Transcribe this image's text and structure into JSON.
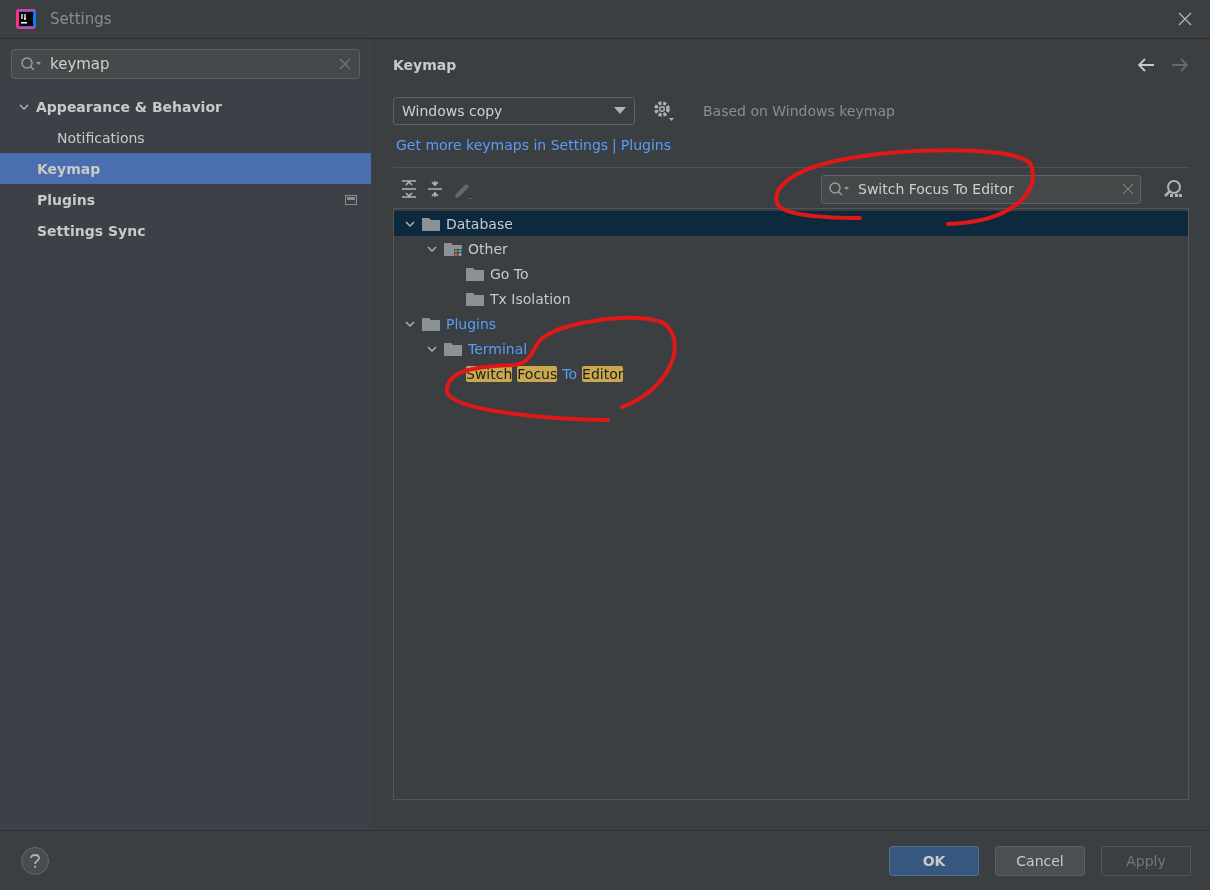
{
  "window": {
    "title": "Settings"
  },
  "sidebar": {
    "search": {
      "value": "keymap"
    },
    "items": [
      {
        "label": "Appearance & Behavior",
        "expanded": true,
        "selected": false,
        "badge": false,
        "children": [
          {
            "label": "Notifications",
            "selected": false,
            "badge": false
          }
        ]
      },
      {
        "label": "Keymap",
        "selected": true,
        "badge": false
      },
      {
        "label": "Plugins",
        "selected": false,
        "badge": true
      },
      {
        "label": "Settings Sync",
        "selected": false,
        "badge": false
      }
    ]
  },
  "page": {
    "title": "Keymap",
    "keymap_select": {
      "value": "Windows copy"
    },
    "based_on": "Based on Windows keymap",
    "links": [
      "Get more keymaps in Settings",
      "|",
      "Plugins"
    ],
    "toolbar": [
      {
        "kind": "expand",
        "disabled": false
      },
      {
        "kind": "collapse",
        "disabled": false
      },
      {
        "kind": "edit",
        "disabled": true
      }
    ],
    "filter": {
      "value": "Switch Focus To Editor"
    },
    "tree": [
      {
        "kind": "folder",
        "label": [
          {
            "text": "Database",
            "match": false
          }
        ],
        "expanded": true,
        "selected": true,
        "modified": false,
        "children": [
          {
            "kind": "group",
            "label": [
              {
                "text": "Other",
                "match": false
              }
            ],
            "expanded": true,
            "selected": false,
            "modified": false,
            "children": [
              {
                "kind": "folder",
                "label": [
                  {
                    "text": "Go To",
                    "match": false
                  }
                ],
                "selected": false,
                "modified": false
              },
              {
                "kind": "folder",
                "label": [
                  {
                    "text": "Tx Isolation",
                    "match": false
                  }
                ],
                "selected": false,
                "modified": false
              }
            ]
          }
        ]
      },
      {
        "kind": "folder",
        "label": [
          {
            "text": "Plugins",
            "match": false
          }
        ],
        "expanded": true,
        "selected": false,
        "modified": true,
        "children": [
          {
            "kind": "folder",
            "label": [
              {
                "text": "Terminal",
                "match": false
              }
            ],
            "expanded": true,
            "selected": false,
            "modified": true,
            "children": [
              {
                "kind": "action",
                "label": [
                  {
                    "text": "Switch",
                    "match": true
                  },
                  {
                    "text": "Focus",
                    "match": true
                  },
                  {
                    "text": "To",
                    "match": false
                  },
                  {
                    "text": "Editor",
                    "match": true
                  }
                ],
                "selected": false,
                "modified": true
              }
            ]
          }
        ]
      }
    ]
  },
  "buttons": [
    {
      "label": "OK",
      "kind": "primary",
      "disabled": false
    },
    {
      "label": "Cancel",
      "kind": "normal",
      "disabled": false
    },
    {
      "label": "Apply",
      "kind": "normal",
      "disabled": true
    }
  ]
}
